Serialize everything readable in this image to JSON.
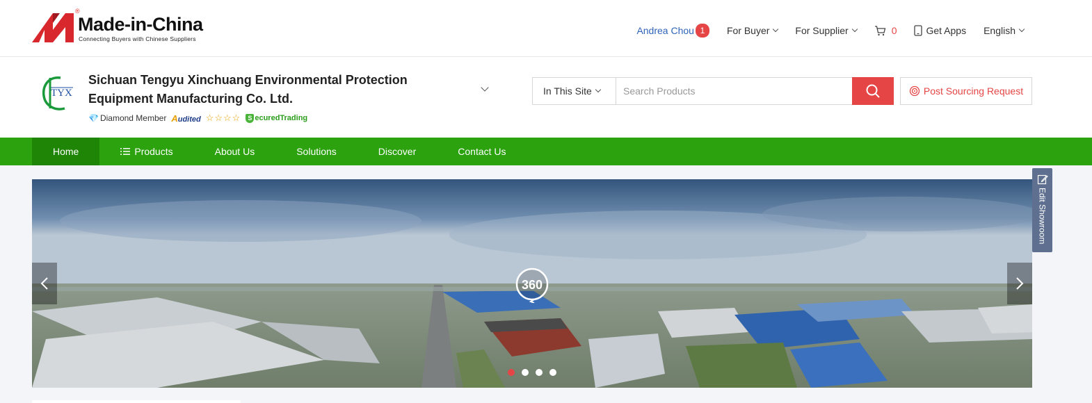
{
  "brand": {
    "name": "Made-in-China",
    "registered": "®",
    "tagline": "Connecting Buyers with Chinese Suppliers",
    "accent": "#e64545"
  },
  "topnav": {
    "user_name": "Andrea Chou",
    "user_badge": "1",
    "for_buyer": "For Buyer",
    "for_supplier": "For Supplier",
    "cart_count": "0",
    "get_apps": "Get Apps",
    "language": "English"
  },
  "company": {
    "logo_text": "TYX",
    "name": "Sichuan Tengyu Xinchuang Environmental Protection Equipment Manufacturing Co. Ltd.",
    "member_level": "Diamond Member",
    "audited_label": "udited",
    "audited_initial": "A",
    "stars": "☆☆☆☆",
    "secured_label": "ecuredTrading",
    "secured_initial": "S"
  },
  "search": {
    "scope": "In This Site",
    "placeholder": "Search Products",
    "post_request": "Post Sourcing Request"
  },
  "mainnav": {
    "tabs": [
      "Home",
      "Products",
      "About Us",
      "Solutions",
      "Discover",
      "Contact Us"
    ],
    "active": "Home",
    "color": "#2ba20e"
  },
  "banner": {
    "pano_label": "360",
    "slides": 4,
    "active_slide": 1
  },
  "side": {
    "edit_showroom": "Edit Showroom"
  }
}
